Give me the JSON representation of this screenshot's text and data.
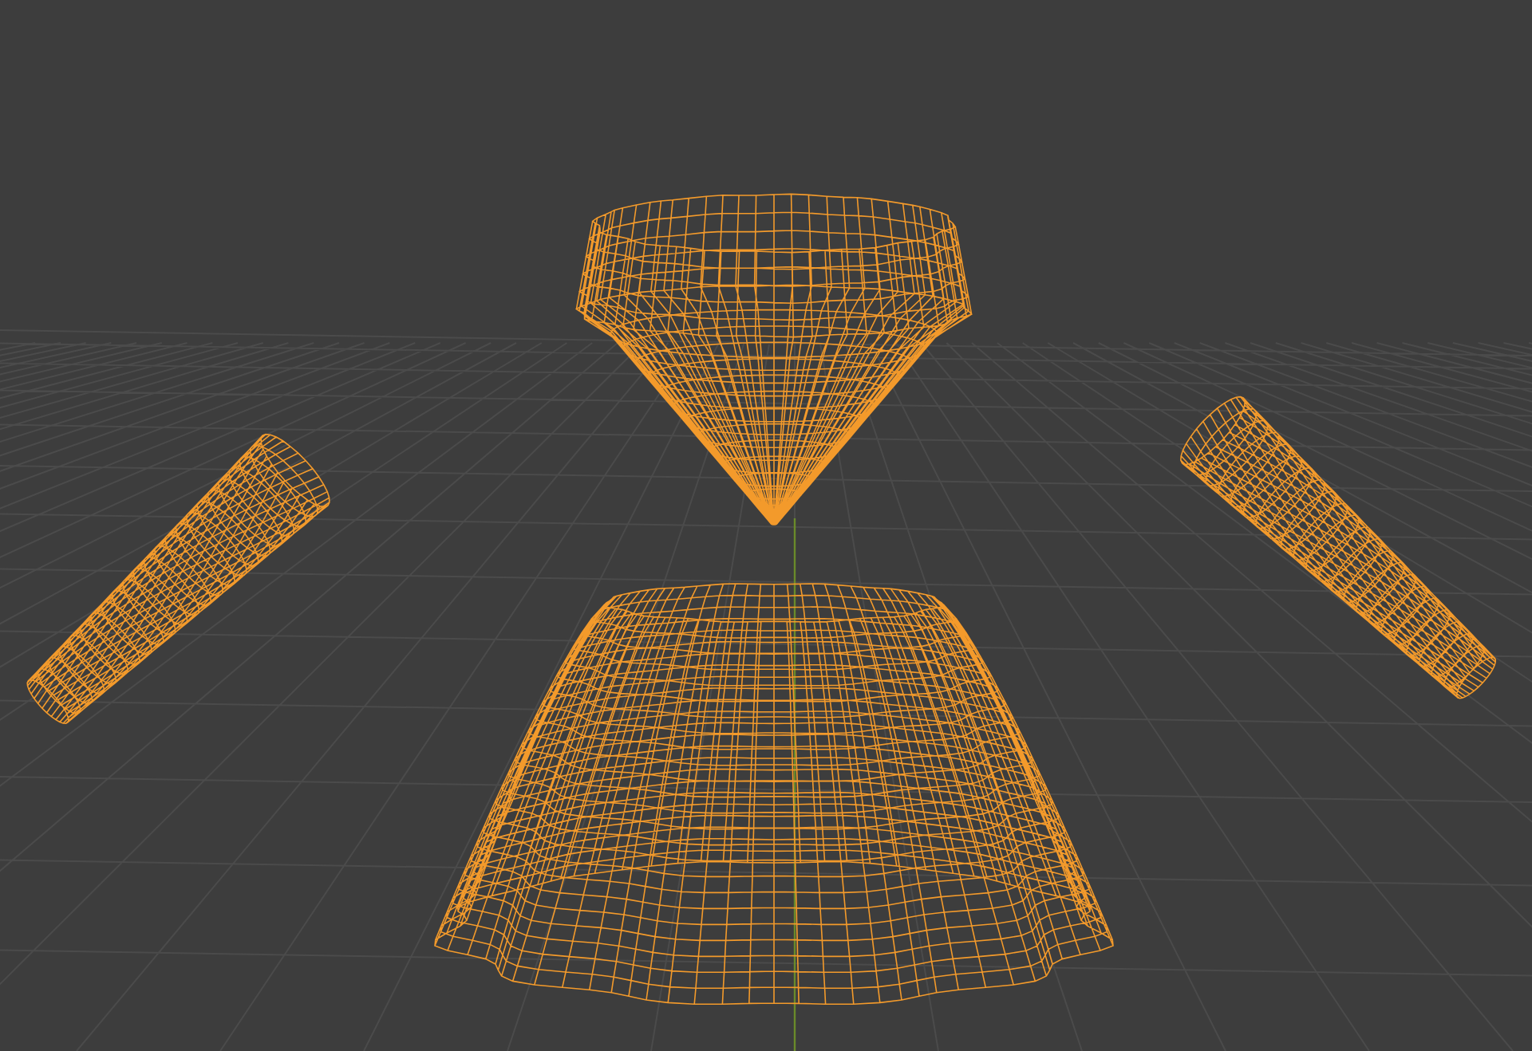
{
  "viewport": {
    "objects": [
      {
        "kind": "bodice",
        "selected": true
      },
      {
        "kind": "sleeve-left",
        "selected": true
      },
      {
        "kind": "sleeve-right",
        "selected": true
      },
      {
        "kind": "skirt",
        "selected": true
      }
    ]
  }
}
